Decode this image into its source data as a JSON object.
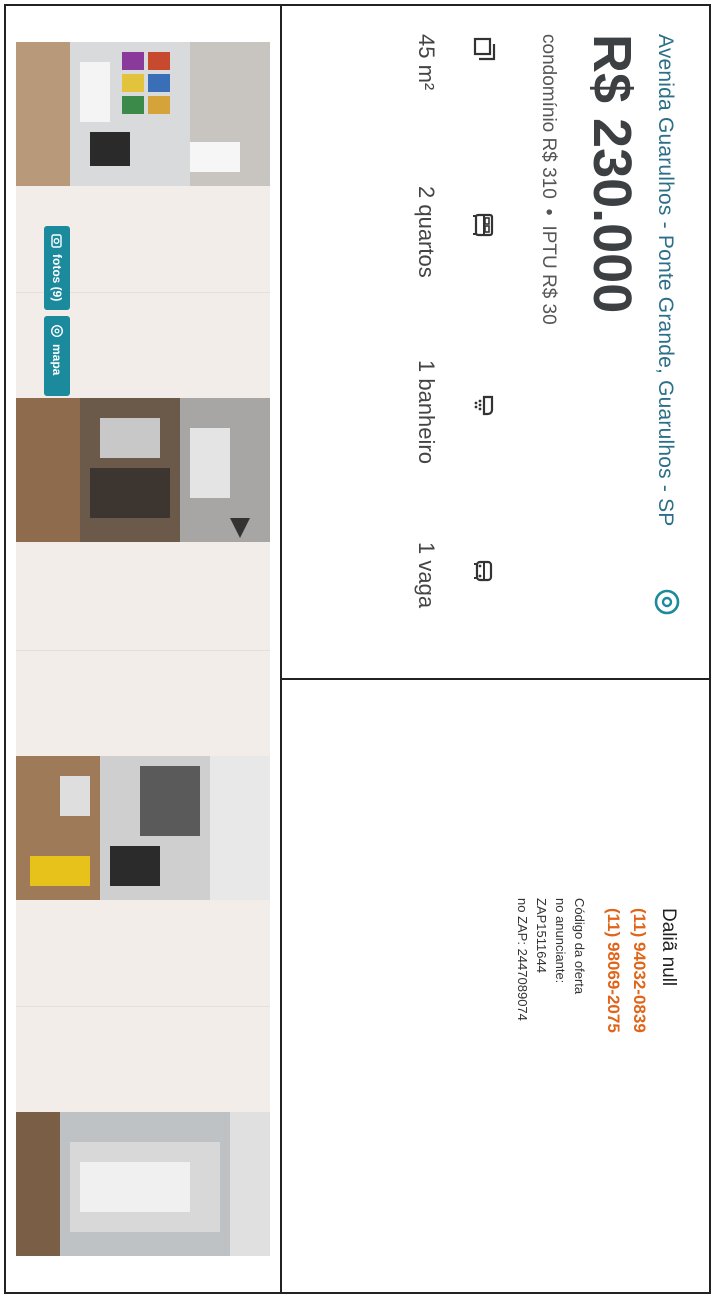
{
  "listing": {
    "address": "Avenida Guarulhos - Ponte Grande, Guarulhos - SP",
    "price": "R$ 230.000",
    "condo_label": "condomínio R$ 310",
    "separator": "•",
    "iptu_label": "IPTU R$ 30",
    "features": [
      {
        "icon": "area-icon",
        "label": "45 m²"
      },
      {
        "icon": "bed-icon",
        "label": "2 quartos"
      },
      {
        "icon": "shower-icon",
        "label": "1 banheiro"
      },
      {
        "icon": "car-icon",
        "label": "1 vaga"
      }
    ]
  },
  "contact": {
    "name": "Daliã null",
    "phones": [
      "(11) 94032-0839",
      "(11) 98069-2075"
    ],
    "code_title": "Código da oferta",
    "code_advertiser_label": "no anunciante:",
    "code_advertiser_value": "ZAP1511644",
    "code_zap": "no ZAP: 2447089074"
  },
  "gallery": {
    "photos_button": "fotos (9)",
    "map_button": "mapa"
  },
  "colors": {
    "address": "#2b6f88",
    "phone": "#e0651a",
    "button": "#1a8a9c",
    "placeholder": "#f2ede8"
  }
}
